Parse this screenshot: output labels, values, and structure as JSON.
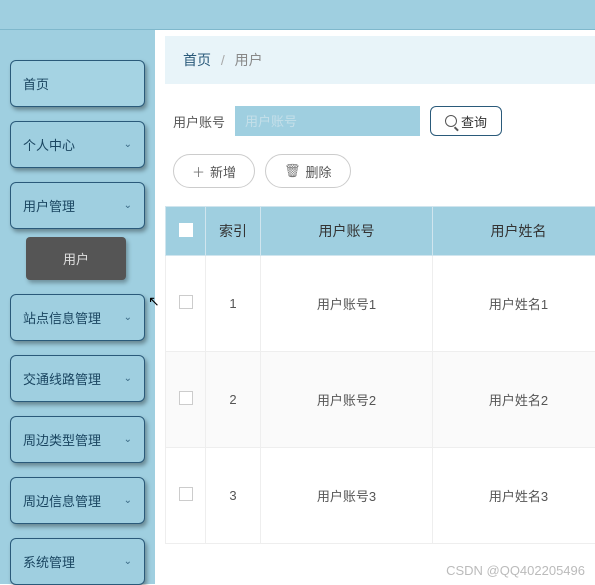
{
  "sidebar": {
    "items": [
      {
        "label": "首页",
        "expandable": false
      },
      {
        "label": "个人中心",
        "expandable": true
      },
      {
        "label": "用户管理",
        "expandable": true,
        "sub": "用户"
      },
      {
        "label": "站点信息管理",
        "expandable": true
      },
      {
        "label": "交通线路管理",
        "expandable": true
      },
      {
        "label": "周边类型管理",
        "expandable": true
      },
      {
        "label": "周边信息管理",
        "expandable": true
      },
      {
        "label": "系统管理",
        "expandable": true
      }
    ]
  },
  "breadcrumb": {
    "home": "首页",
    "current": "用户"
  },
  "filter": {
    "label": "用户账号",
    "placeholder": "用户账号",
    "searchLabel": "查询"
  },
  "actions": {
    "add": "新增",
    "delete": "删除"
  },
  "table": {
    "headers": {
      "index": "索引",
      "account": "用户账号",
      "name": "用户姓名"
    },
    "rows": [
      {
        "index": "1",
        "account": "用户账号1",
        "name": "用户姓名1"
      },
      {
        "index": "2",
        "account": "用户账号2",
        "name": "用户姓名2"
      },
      {
        "index": "3",
        "account": "用户账号3",
        "name": "用户姓名3"
      }
    ]
  },
  "watermark": "CSDN @QQ402205496"
}
